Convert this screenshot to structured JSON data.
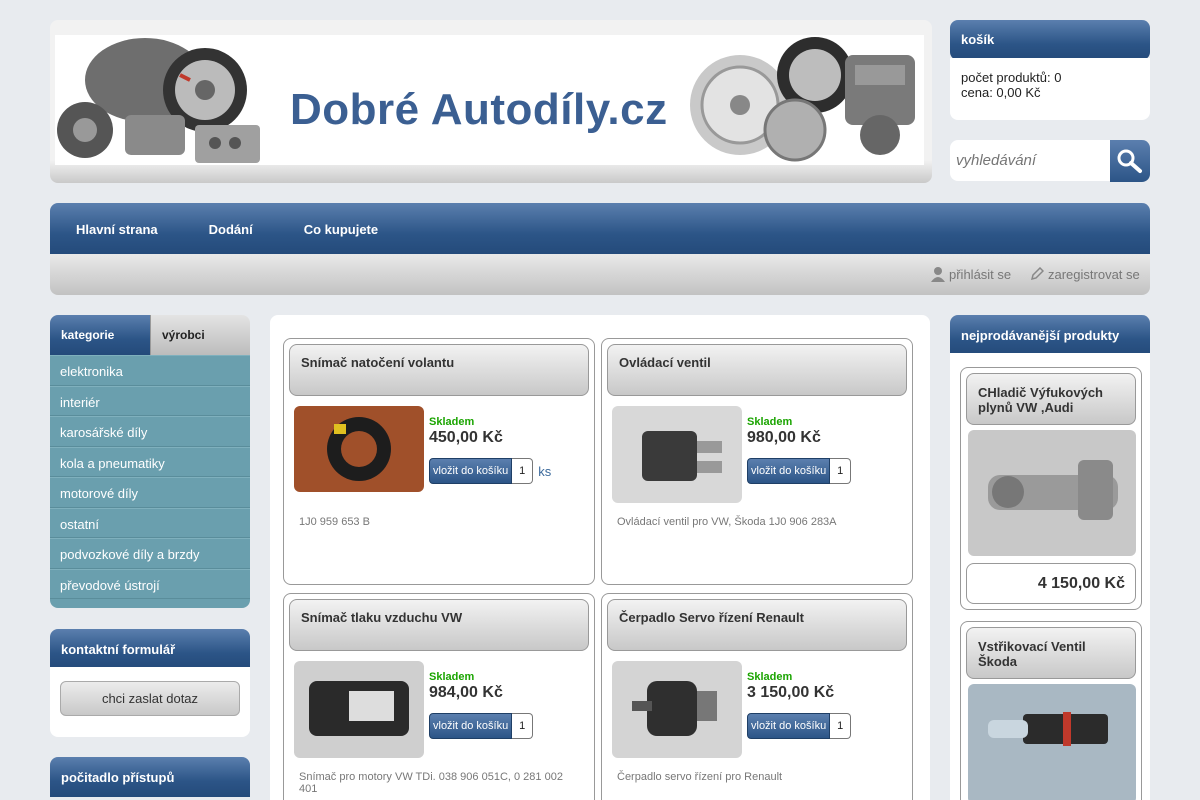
{
  "site": {
    "title": "Dobré Autodíly.cz"
  },
  "cart": {
    "title": "košík",
    "count_line": "počet produktů: 0",
    "price_line": "cena: 0,00 Kč"
  },
  "search": {
    "placeholder": "vyhledávání"
  },
  "nav": {
    "items": [
      "Hlavní strana",
      "Dodání",
      "Co kupujete"
    ]
  },
  "account": {
    "login": "přihlásit se",
    "register": "zaregistrovat se"
  },
  "sidebar": {
    "tabs": [
      "kategorie",
      "výrobci"
    ],
    "categories": [
      "elektronika",
      "interiér",
      "karosářské díly",
      "kola a pneumatiky",
      "motorové díly",
      "ostatní",
      "podvozkové díly a brzdy",
      "převodové ústrojí"
    ],
    "contact_title": "kontaktní formulář",
    "contact_button": "chci zaslat dotaz",
    "counter_title": "počitadlo přístupů"
  },
  "products": [
    {
      "name": "Snímač natočení volantu",
      "stock": "Skladem",
      "price": "450,00 Kč",
      "add_label": "vložit do košíku",
      "qty": "1",
      "unit": "ks",
      "desc": "1J0 959 653 B"
    },
    {
      "name": "Ovládací ventil",
      "stock": "Skladem",
      "price": "980,00 Kč",
      "add_label": "vložit do košíku",
      "qty": "1",
      "unit": "",
      "desc": "Ovládací ventil pro VW, Škoda 1J0 906 283A"
    },
    {
      "name": "Snímač tlaku vzduchu VW",
      "stock": "Skladem",
      "price": "984,00 Kč",
      "add_label": "vložit do košíku",
      "qty": "1",
      "unit": "",
      "desc": "Snímač pro motory VW TDi. 038 906 051C, 0 281 002 401"
    },
    {
      "name": "Čerpadlo Servo řízení Renault",
      "stock": "Skladem",
      "price": "3 150,00 Kč",
      "add_label": "vložit do košíku",
      "qty": "1",
      "unit": "",
      "desc": "Čerpadlo servo řízení pro Renault"
    }
  ],
  "bestsellers": {
    "title": "nejprodávanější produkty",
    "items": [
      {
        "name": "CHladič Výfukových plynů VW ,Audi",
        "price": "4 150,00 Kč"
      },
      {
        "name": "Vstřikovací Ventil Škoda",
        "price": ""
      }
    ]
  }
}
